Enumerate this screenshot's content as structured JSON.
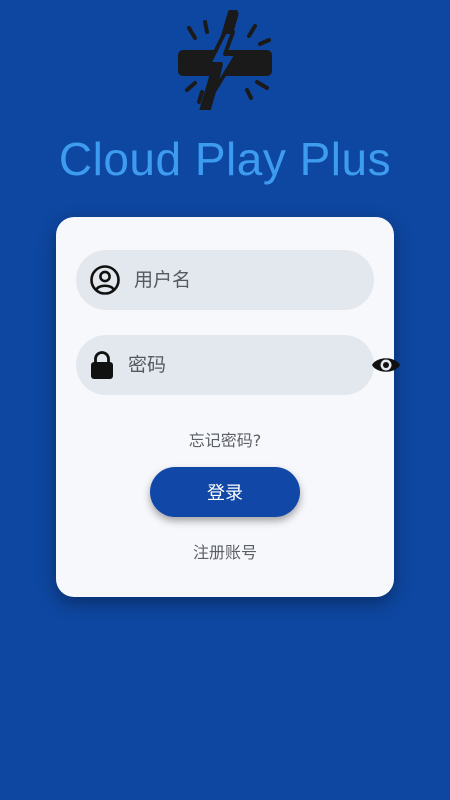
{
  "app": {
    "title": "Cloud Play Plus",
    "title_color": "#3d9bf0",
    "background_color": "#0e47a1",
    "logo_icon": "lightning-bolt-logo-icon"
  },
  "login_form": {
    "username": {
      "placeholder": "用户名",
      "value": "",
      "icon": "user-circle-icon"
    },
    "password": {
      "placeholder": "密码",
      "value": "",
      "icon": "lock-icon",
      "toggle_icon": "eye-icon"
    },
    "forgot_password_label": "忘记密码?",
    "login_button_label": "登录",
    "login_button_color": "#1147a6",
    "register_label": "注册账号"
  }
}
